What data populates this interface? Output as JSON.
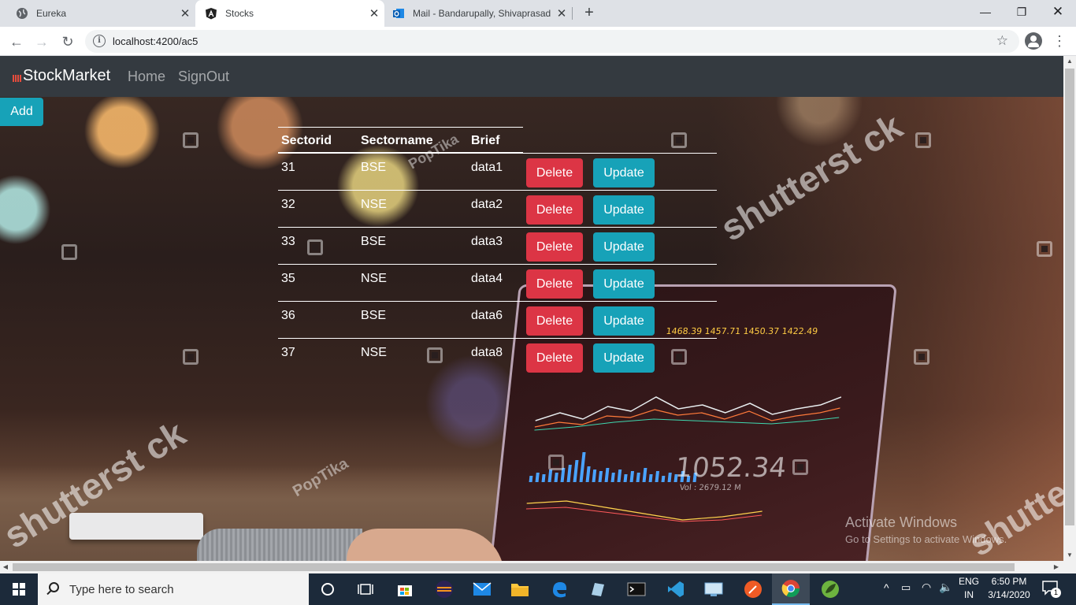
{
  "browser": {
    "tabs": [
      {
        "title": "Eureka",
        "active": false,
        "icon": "globe-icon"
      },
      {
        "title": "Stocks",
        "active": true,
        "icon": "angular-icon"
      },
      {
        "title": "Mail - Bandarupally, Shivaprasad",
        "active": false,
        "icon": "outlook-icon"
      }
    ],
    "url": "localhost:4200/ac5"
  },
  "app": {
    "brand": "StockMarket",
    "nav": [
      {
        "label": "Home"
      },
      {
        "label": "SignOut"
      }
    ],
    "add_label": "Add"
  },
  "table": {
    "headers": [
      "Sectorid",
      "Sectorname",
      "Brief"
    ],
    "delete_label": "Delete",
    "update_label": "Update",
    "rows": [
      {
        "id": "31",
        "name": "BSE",
        "brief": "data1"
      },
      {
        "id": "32",
        "name": "NSE",
        "brief": "data2"
      },
      {
        "id": "33",
        "name": "BSE",
        "brief": "data3"
      },
      {
        "id": "35",
        "name": "NSE",
        "brief": "data4"
      },
      {
        "id": "36",
        "name": "BSE",
        "brief": "data6"
      },
      {
        "id": "37",
        "name": "NSE",
        "brief": "data8"
      }
    ]
  },
  "background": {
    "watermarks": [
      "shutterst  ck",
      "PopTika"
    ],
    "laptop_ticker": "1468.39  1457.71  1450.37  1422.49",
    "laptop_value": "1052.34",
    "laptop_vol": "Vol : 2679.12 M"
  },
  "activation": {
    "title": "Activate Windows",
    "subtitle": "Go to Settings to activate Windows."
  },
  "taskbar": {
    "search_placeholder": "Type here to search",
    "lang_line1": "ENG",
    "lang_line2": "IN",
    "time": "6:50 PM",
    "date": "3/14/2020",
    "notification_count": "1"
  },
  "colors": {
    "navbar": "#343a40",
    "danger": "#dc3545",
    "info": "#17a2b8"
  }
}
